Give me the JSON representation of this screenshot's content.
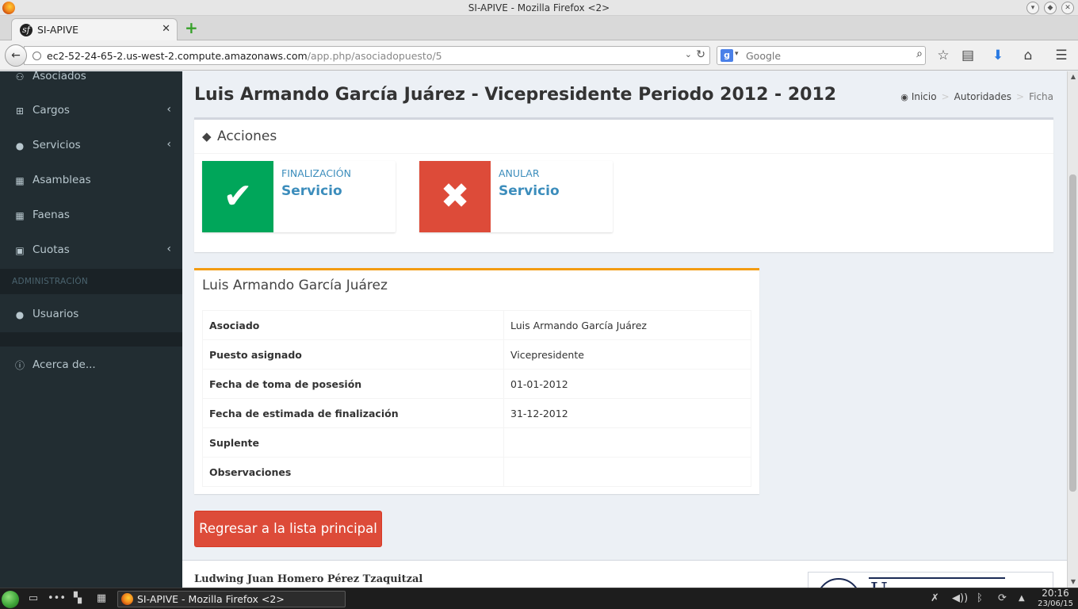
{
  "window": {
    "title": "SI-APIVE - Mozilla Firefox <2>"
  },
  "browser": {
    "tab_title": "SI-APIVE",
    "url_host": "ec2-52-24-65-2.us-west-2.compute.amazonaws.com",
    "url_path": "/app.php/asociadopuesto/5",
    "search_placeholder": "Google"
  },
  "sidebar": {
    "items": [
      {
        "label": "Asociados",
        "icon": "users-icon"
      },
      {
        "label": "Cargos",
        "icon": "sitemap-icon"
      },
      {
        "label": "Servicios",
        "icon": "tint-icon"
      },
      {
        "label": "Asambleas",
        "icon": "calendar-icon"
      },
      {
        "label": "Faenas",
        "icon": "calendar-icon"
      },
      {
        "label": "Cuotas",
        "icon": "money-icon"
      }
    ],
    "section_header": "ADMINISTRACIÓN",
    "admin_items": [
      {
        "label": "Usuarios",
        "icon": "user-icon"
      }
    ],
    "about_label": "Acerca de..."
  },
  "page": {
    "title": "Luis Armando García Juárez - Vicepresidente Periodo 2012 - 2012",
    "breadcrumb": [
      "Inicio",
      "Autoridades",
      "Ficha"
    ]
  },
  "acciones": {
    "title": "Acciones",
    "boxes": [
      {
        "label": "FINALIZACIÓN",
        "value": "Servicio",
        "color": "#00a65a",
        "icon": "check-icon"
      },
      {
        "label": "ANULAR",
        "value": "Servicio",
        "color": "#dd4b39",
        "icon": "times-icon"
      }
    ]
  },
  "detail": {
    "title": "Luis Armando García Juárez",
    "rows": [
      {
        "label": "Asociado",
        "value": "Luis Armando García Juárez"
      },
      {
        "label": "Puesto asignado",
        "value": "Vicepresidente"
      },
      {
        "label": "Fecha de toma de posesión",
        "value": "01-01-2012"
      },
      {
        "label": "Fecha de estimada de finalización",
        "value": "31-12-2012"
      },
      {
        "label": "Suplente",
        "value": ""
      },
      {
        "label": "Observaciones",
        "value": ""
      }
    ]
  },
  "return_button": "Regresar a la lista principal",
  "footer": {
    "author": "Ludwing Juan Homero Pérez Tzaquitzal"
  },
  "taskbar": {
    "window_label": "SI-APIVE - Mozilla Firefox <2>",
    "time": "20:16",
    "date": "23/06/15"
  },
  "colors": {
    "sidebar_bg": "#222d32",
    "success": "#00a65a",
    "danger": "#dd4b39",
    "warning": "#f39c12",
    "link": "#3c8dbc"
  }
}
